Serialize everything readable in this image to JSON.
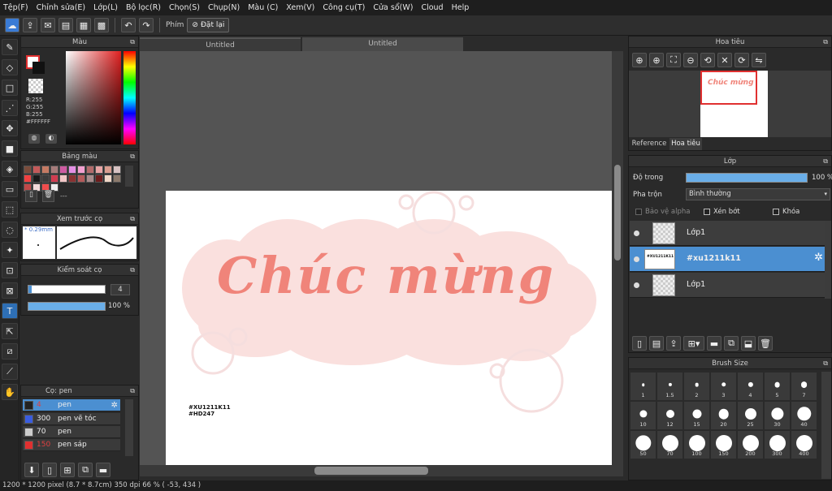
{
  "menu": [
    "Tệp(F)",
    "Chỉnh sửa(E)",
    "Lớp(L)",
    "Bộ lọc(R)",
    "Chọn(S)",
    "Chụp(N)",
    "Màu (C)",
    "Xem(V)",
    "Công cụ(T)",
    "Cửa sổ(W)",
    "Cloud",
    "Help"
  ],
  "toolbar": {
    "phim_label": "Phím",
    "reset_label": "Đặt lại"
  },
  "tabs": [
    "Untitled",
    "Untitled"
  ],
  "color_panel": {
    "title": "Màu",
    "r": "R:255",
    "g": "G:255",
    "b": "B:255",
    "hex": "#FFFFFF"
  },
  "palette_panel": {
    "title": "Bảng màu",
    "ellipsis": "---",
    "colors": [
      "#7a4c3c",
      "#c35959",
      "#c57a63",
      "#a67b7a",
      "#ce5ba2",
      "#e48fe4",
      "#f2a0d0",
      "#b26a6a",
      "#e8a5a5",
      "#d99c8e",
      "#d7c2c2",
      "#f04040",
      "#1a1a1a",
      "#3c3c3c",
      "#d03c50",
      "#f2c6c6",
      "#8a3232",
      "#b45a5a",
      "#a88c8c",
      "#6c1c1c",
      "#f0d8c8",
      "#8c7a6c",
      "#c04848",
      "#f2dada",
      "#f04c4c",
      "#eeeeee"
    ]
  },
  "preview_panel": {
    "title": "Xem trước cọ",
    "size": "0.29mm"
  },
  "brush_control": {
    "title": "Kiểm soát cọ",
    "size_value": "4",
    "opacity_value": "100 %"
  },
  "brushes": {
    "title": "Cọ: pen",
    "items": [
      {
        "size": "4",
        "name": "pen",
        "color": "#222222",
        "selected": true
      },
      {
        "size": "300",
        "name": "pen vẽ tóc",
        "color": "#3a5de0",
        "selected": false
      },
      {
        "size": "70",
        "name": "pen",
        "color": "#cccccc",
        "selected": false
      },
      {
        "size": "150",
        "name": "pen sáp",
        "color": "#e03030",
        "selected": false
      }
    ]
  },
  "navigator": {
    "title": "Hoa tiêu",
    "thumb_text": "Chúc mừng",
    "tab_reference": "Reference",
    "tab_navigator": "Hoa tiêu"
  },
  "layers_panel": {
    "title": "Lớp",
    "opacity_label": "Độ trong",
    "opacity_value": "100 %",
    "blend_label": "Pha trộn",
    "blend_value": "Bình thường",
    "protect_alpha": "Bảo vệ alpha",
    "clipping": "Xén bớt",
    "lock": "Khóa",
    "layers": [
      {
        "name": "Lớp1",
        "selected": false,
        "thumb_text": ""
      },
      {
        "name": "#xu1211k11",
        "selected": true,
        "thumb_text": "#XU1211K11 #HD247"
      },
      {
        "name": "Lớp1",
        "selected": false,
        "thumb_text": ""
      }
    ]
  },
  "brush_size_panel": {
    "title": "Brush Size",
    "sizes": [
      "1",
      "1.5",
      "2",
      "3",
      "4",
      "5",
      "7",
      "10",
      "12",
      "15",
      "20",
      "25",
      "30",
      "40",
      "50",
      "70",
      "100",
      "150",
      "200",
      "300",
      "400"
    ]
  },
  "canvas": {
    "main_text": "Chúc mừng",
    "tag_line_1": "#XU1211K11",
    "tag_line_2": "#HD247"
  },
  "status": {
    "dimensions": "1200 * 1200 pixel",
    "physical": "(8.7 * 8.7cm)",
    "dpi": "350 dpi",
    "zoom": "66 %",
    "coords": "( -53, 434 )"
  },
  "colors": {
    "accent": "#4b8fd1",
    "text_pink": "#f0847a",
    "cloud_pink": "#fae0de"
  }
}
